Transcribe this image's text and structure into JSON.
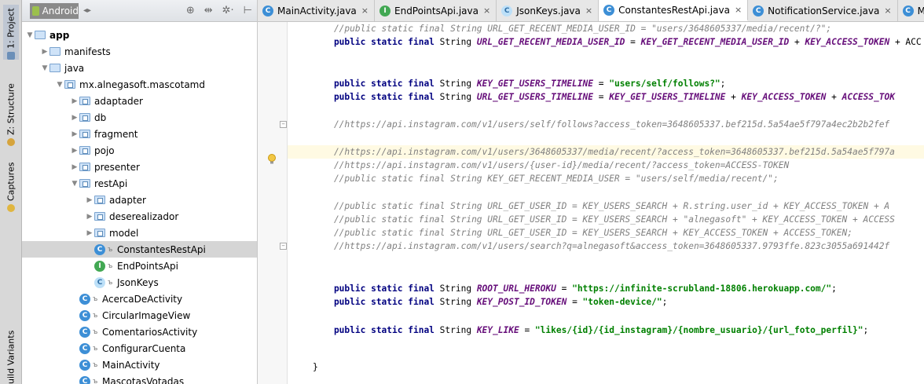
{
  "sidebar_tabs": [
    {
      "label": "1: Project",
      "icon": "project-icon"
    },
    {
      "label": "Z: Structure",
      "icon": "structure-icon"
    },
    {
      "label": "Captures",
      "icon": "captures-icon"
    },
    {
      "label": "uild Variants",
      "icon": "build-variants-icon"
    }
  ],
  "project_toolbar": {
    "view_selector": "Android",
    "icons": [
      "sync-icon",
      "collapse-icon",
      "settings-icon",
      "hide-icon"
    ]
  },
  "tree": [
    {
      "label": "app",
      "type": "module",
      "depth": 0,
      "open": true
    },
    {
      "label": "manifests",
      "type": "folder",
      "depth": 1,
      "open": false
    },
    {
      "label": "java",
      "type": "folder",
      "depth": 1,
      "open": true
    },
    {
      "label": "mx.alnegasoft.mascotamd",
      "type": "package",
      "depth": 2,
      "open": true
    },
    {
      "label": "adaptader",
      "type": "package",
      "depth": 3,
      "open": false
    },
    {
      "label": "db",
      "type": "package",
      "depth": 3,
      "open": false
    },
    {
      "label": "fragment",
      "type": "package",
      "depth": 3,
      "open": false
    },
    {
      "label": "pojo",
      "type": "package",
      "depth": 3,
      "open": false
    },
    {
      "label": "presenter",
      "type": "package",
      "depth": 3,
      "open": false
    },
    {
      "label": "restApi",
      "type": "package",
      "depth": 3,
      "open": true
    },
    {
      "label": "adapter",
      "type": "package",
      "depth": 4,
      "open": false
    },
    {
      "label": "deserealizador",
      "type": "package",
      "depth": 4,
      "open": false
    },
    {
      "label": "model",
      "type": "package",
      "depth": 4,
      "open": false
    },
    {
      "label": "ConstantesRestApi",
      "type": "class",
      "depth": 4,
      "selected": true
    },
    {
      "label": "EndPointsApi",
      "type": "interface",
      "depth": 4
    },
    {
      "label": "JsonKeys",
      "type": "class-ghost",
      "depth": 4
    },
    {
      "label": "AcercaDeActivity",
      "type": "class",
      "depth": 3
    },
    {
      "label": "CircularImageView",
      "type": "class",
      "depth": 3
    },
    {
      "label": "ComentariosActivity",
      "type": "class",
      "depth": 3
    },
    {
      "label": "ConfigurarCuenta",
      "type": "class",
      "depth": 3
    },
    {
      "label": "MainActivity",
      "type": "class",
      "depth": 3
    },
    {
      "label": "MascotasVotadas",
      "type": "class",
      "depth": 3
    }
  ],
  "editor_tabs": [
    {
      "label": "MainActivity.java",
      "badge": "C",
      "kind": "class",
      "active": false
    },
    {
      "label": "EndPointsApi.java",
      "badge": "I",
      "kind": "interface",
      "active": false
    },
    {
      "label": "JsonKeys.java",
      "badge": "C",
      "kind": "class-ghost",
      "active": false
    },
    {
      "label": "ConstantesRestApi.java",
      "badge": "C",
      "kind": "class",
      "active": true
    },
    {
      "label": "NotificationService.java",
      "badge": "C",
      "kind": "class",
      "active": false
    },
    {
      "label": "Mas",
      "badge": "C",
      "kind": "class",
      "active": false
    }
  ],
  "code_lines": [
    {
      "parts": [
        [
          "cmt",
          "    //public static final String URL_GET_RECENT_MEDIA_USER_ID = \"users/3648605337/media/recent/?\";"
        ]
      ]
    },
    {
      "parts": [
        [
          "kw",
          "    public static final "
        ],
        [
          "",
          "String "
        ],
        [
          "field",
          "URL_GET_RECENT_MEDIA_USER_ID"
        ],
        [
          "",
          " = "
        ],
        [
          "field",
          "KEY_GET_RECENT_MEDIA_USER_ID"
        ],
        [
          "",
          " + "
        ],
        [
          "field",
          "KEY_ACCESS_TOKEN"
        ],
        [
          "",
          " + ACC"
        ]
      ]
    },
    {
      "parts": []
    },
    {
      "parts": []
    },
    {
      "parts": [
        [
          "kw",
          "    public static final "
        ],
        [
          "",
          "String "
        ],
        [
          "field",
          "KEY_GET_USERS_TIMELINE"
        ],
        [
          "",
          " = "
        ],
        [
          "str",
          "\"users/self/follows?\""
        ],
        [
          "",
          ";"
        ]
      ]
    },
    {
      "parts": [
        [
          "kw",
          "    public static final "
        ],
        [
          "",
          "String "
        ],
        [
          "field",
          "URL_GET_USERS_TIMELINE"
        ],
        [
          "",
          " = "
        ],
        [
          "field",
          "KEY_GET_USERS_TIMELINE"
        ],
        [
          "",
          " + "
        ],
        [
          "field",
          "KEY_ACCESS_TOKEN"
        ],
        [
          "",
          " + "
        ],
        [
          "field",
          "ACCESS_TOK"
        ]
      ]
    },
    {
      "parts": []
    },
    {
      "parts": [
        [
          "cmt",
          "    //https://api.instagram.com/v1/users/self/follows?access_token=3648605337.bef215d.5a54ae5f797a4ec2b2b2fef"
        ]
      ]
    },
    {
      "parts": []
    },
    {
      "parts": [
        [
          "cmt",
          "    //https://api.instagram.com/v1/users/3648605337/media/recent/?access_token=3648605337.bef215d.5a54ae5f797a"
        ]
      ],
      "highlight": true
    },
    {
      "parts": [
        [
          "cmt",
          "    //https://api.instagram.com/v1/users/{user-id}/media/recent/?access_token=ACCESS-TOKEN"
        ]
      ]
    },
    {
      "parts": [
        [
          "cmt",
          "    //public static final String KEY_GET_RECENT_MEDIA_USER = \"users/self/media/recent/\";"
        ]
      ]
    },
    {
      "parts": []
    },
    {
      "parts": [
        [
          "cmt",
          "    //public static final String URL_GET_USER_ID = KEY_USERS_SEARCH + R.string.user_id + KEY_ACCESS_TOKEN + A"
        ]
      ]
    },
    {
      "parts": [
        [
          "cmt",
          "    //public static final String URL_GET_USER_ID = KEY_USERS_SEARCH + \"alnegasoft\" + KEY_ACCESS_TOKEN + ACCESS"
        ]
      ]
    },
    {
      "parts": [
        [
          "cmt",
          "    //public static final String URL_GET_USER_ID = KEY_USERS_SEARCH + KEY_ACCESS_TOKEN + ACCESS_TOKEN;"
        ]
      ]
    },
    {
      "parts": [
        [
          "cmt",
          "    //https://api.instagram.com/v1/users/search?q=alnegasoft&access_token=3648605337.9793ffe.823c3055a691442f"
        ]
      ]
    },
    {
      "parts": []
    },
    {
      "parts": []
    },
    {
      "parts": [
        [
          "kw",
          "    public static final "
        ],
        [
          "",
          "String "
        ],
        [
          "field",
          "ROOT_URL_HEROKU"
        ],
        [
          "",
          " = "
        ],
        [
          "str",
          "\"https://infinite-scrubland-18806.herokuapp.com/\""
        ],
        [
          "",
          ";"
        ]
      ]
    },
    {
      "parts": [
        [
          "kw",
          "    public static final "
        ],
        [
          "",
          "String "
        ],
        [
          "field",
          "KEY_POST_ID_TOKEN"
        ],
        [
          "",
          " = "
        ],
        [
          "str",
          "\"token-device/\""
        ],
        [
          "",
          ";"
        ]
      ]
    },
    {
      "parts": []
    },
    {
      "parts": [
        [
          "kw",
          "    public static final "
        ],
        [
          "",
          "String "
        ],
        [
          "field",
          "KEY_LIKE"
        ],
        [
          "",
          " = "
        ],
        [
          "str",
          "\"likes/{id}/{id_instagram}/{nombre_usuario}/{url_foto_perfil}\""
        ],
        [
          "",
          ";"
        ]
      ]
    },
    {
      "parts": []
    },
    {
      "parts": []
    },
    {
      "parts": [
        [
          "",
          "}"
        ]
      ]
    }
  ],
  "colors": {
    "keyword": "#000080",
    "field": "#660e7a",
    "string": "#008000",
    "comment": "#808080",
    "highlight_line": "#fffae3",
    "selected_row": "#d5d5d5"
  }
}
